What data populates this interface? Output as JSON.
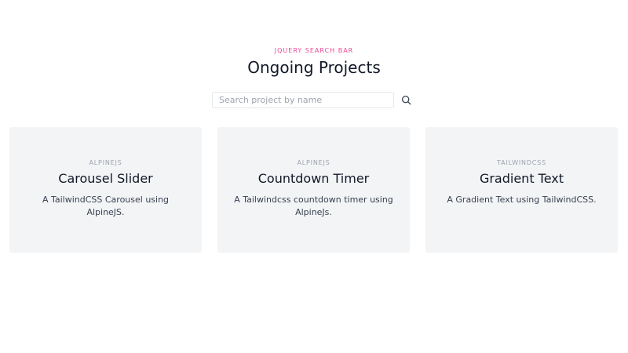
{
  "header": {
    "eyebrow": "JQUERY SEARCH BAR",
    "title": "Ongoing Projects"
  },
  "search": {
    "placeholder": "Search project by name",
    "value": "",
    "button_icon": "search-icon"
  },
  "projects": [
    {
      "tag": "ALPINEJS",
      "title": "Carousel Slider",
      "description": "A TailwindCSS Carousel using AlpineJS."
    },
    {
      "tag": "ALPINEJS",
      "title": "Countdown Timer",
      "description": "A Tailwindcss countdown timer using AlpineJs."
    },
    {
      "tag": "TAILWINDCSS",
      "title": "Gradient Text",
      "description": "A Gradient Text using TailwindCSS."
    }
  ],
  "colors": {
    "accent": "#ec4899",
    "card_bg": "#f3f4f6",
    "muted": "#9ca3af"
  }
}
